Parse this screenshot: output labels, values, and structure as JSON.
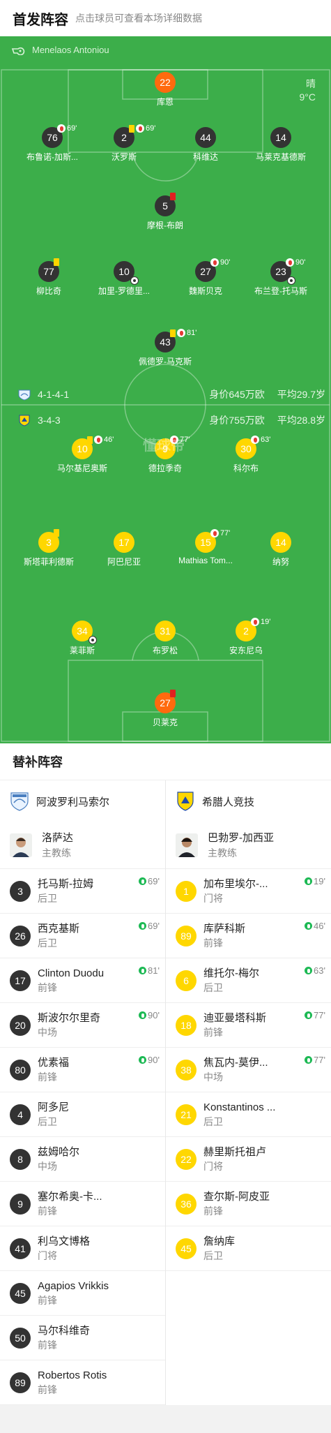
{
  "header": {
    "title": "首发阵容",
    "subtitle": "点击球员可查看本场详细数据"
  },
  "referee": {
    "name": "Menelaos Antoniou",
    "icon": "whistle-icon"
  },
  "weather": {
    "condition": "晴",
    "temp": "9°C"
  },
  "home_team": {
    "formation": "4-1-4-1",
    "value": "身价645万欧",
    "avg_age": "平均29.7岁"
  },
  "away_team": {
    "formation": "3-4-3",
    "value": "身价755万欧",
    "avg_age": "平均28.8岁"
  },
  "watermark": "懂球帝",
  "pitch_players": [
    {
      "num": "22",
      "name": "库恩",
      "style": "gk"
    },
    {
      "num": "76",
      "name": "布鲁诺-加斯...",
      "style": "dark",
      "sub_min": "69'"
    },
    {
      "num": "2",
      "name": "沃罗斯",
      "style": "dark",
      "yellow": true,
      "sub_min": "69'"
    },
    {
      "num": "44",
      "name": "科维达",
      "style": "dark"
    },
    {
      "num": "14",
      "name": "马莱克基德斯",
      "style": "dark"
    },
    {
      "num": "5",
      "name": "摩根-布朗",
      "style": "dark",
      "red": true
    },
    {
      "num": "77",
      "name": "柳比奇",
      "style": "dark",
      "yellow": true
    },
    {
      "num": "10",
      "name": "加里-罗德里...",
      "style": "dark",
      "goal": true
    },
    {
      "num": "27",
      "name": "魏斯贝克",
      "style": "dark",
      "sub_min": "90'"
    },
    {
      "num": "23",
      "name": "布兰登-托马斯",
      "style": "dark",
      "sub_min": "90'",
      "goal": true
    },
    {
      "num": "43",
      "name": "佩德罗-马克斯",
      "style": "dark",
      "yellow": true,
      "sub_min": "81'"
    },
    {
      "num": "10",
      "name": "马尔基尼奥斯",
      "style": "yel",
      "yellow": true,
      "sub_min": "46'"
    },
    {
      "num": "9",
      "name": "德拉季奇",
      "style": "yel",
      "sub_min": "77'"
    },
    {
      "num": "30",
      "name": "科尔布",
      "style": "yel",
      "sub_min": "63'"
    },
    {
      "num": "3",
      "name": "斯塔菲利德斯",
      "style": "yel",
      "yellow": true
    },
    {
      "num": "17",
      "name": "阿巴尼亚",
      "style": "yel"
    },
    {
      "num": "15",
      "name": "Mathias Tom...",
      "style": "yel",
      "sub_min": "77'"
    },
    {
      "num": "14",
      "name": "纳努",
      "style": "yel"
    },
    {
      "num": "34",
      "name": "莱菲斯",
      "style": "yel",
      "goal": true
    },
    {
      "num": "31",
      "name": "布罗松",
      "style": "yel"
    },
    {
      "num": "2",
      "name": "安东尼乌",
      "style": "yel",
      "sub_min": "19'"
    },
    {
      "num": "27",
      "name": "贝莱克",
      "style": "gk",
      "red": true
    }
  ],
  "subs_title": "替补阵容",
  "subs": {
    "home": {
      "club": "阿波罗利马索尔",
      "coach": {
        "name": "洛萨达",
        "role": "主教练"
      },
      "players": [
        {
          "num": "3",
          "name": "托马斯-拉姆",
          "pos": "后卫",
          "min": "69'"
        },
        {
          "num": "26",
          "name": "西克基斯",
          "pos": "后卫",
          "min": "69'"
        },
        {
          "num": "17",
          "name": "Clinton Duodu",
          "pos": "前锋",
          "min": "81'"
        },
        {
          "num": "20",
          "name": "斯波尔尔里奇",
          "pos": "中场",
          "min": "90'"
        },
        {
          "num": "80",
          "name": "优素福",
          "pos": "前锋",
          "min": "90'"
        },
        {
          "num": "4",
          "name": "阿多尼",
          "pos": "后卫"
        },
        {
          "num": "8",
          "name": "兹姆哈尔",
          "pos": "中场"
        },
        {
          "num": "9",
          "name": "塞尔希奥-卡...",
          "pos": "前锋"
        },
        {
          "num": "41",
          "name": "利乌文博格",
          "pos": "门将"
        },
        {
          "num": "45",
          "name": "Agapios Vrikkis",
          "pos": "前锋"
        },
        {
          "num": "50",
          "name": "马尔科维奇",
          "pos": "前锋"
        },
        {
          "num": "89",
          "name": "Robertos Rotis",
          "pos": "前锋"
        }
      ]
    },
    "away": {
      "club": "希腊人竞技",
      "coach": {
        "name": "巴勃罗-加西亚",
        "role": "主教练"
      },
      "players": [
        {
          "num": "1",
          "name": "加布里埃尔-...",
          "pos": "门将",
          "min": "19'"
        },
        {
          "num": "89",
          "name": "库萨科斯",
          "pos": "前锋",
          "min": "46'"
        },
        {
          "num": "6",
          "name": "维托尔-梅尔",
          "pos": "后卫",
          "min": "63'"
        },
        {
          "num": "18",
          "name": "迪亚曼塔科斯",
          "pos": "前锋",
          "min": "77'"
        },
        {
          "num": "38",
          "name": "焦瓦内-莫伊...",
          "pos": "中场",
          "min": "77'"
        },
        {
          "num": "21",
          "name": "Konstantinos ...",
          "pos": "后卫"
        },
        {
          "num": "22",
          "name": "赫里斯托祖卢",
          "pos": "门将"
        },
        {
          "num": "36",
          "name": "查尔斯-阿皮亚",
          "pos": "前锋"
        },
        {
          "num": "45",
          "name": "詹纳库",
          "pos": "后卫"
        }
      ]
    }
  }
}
